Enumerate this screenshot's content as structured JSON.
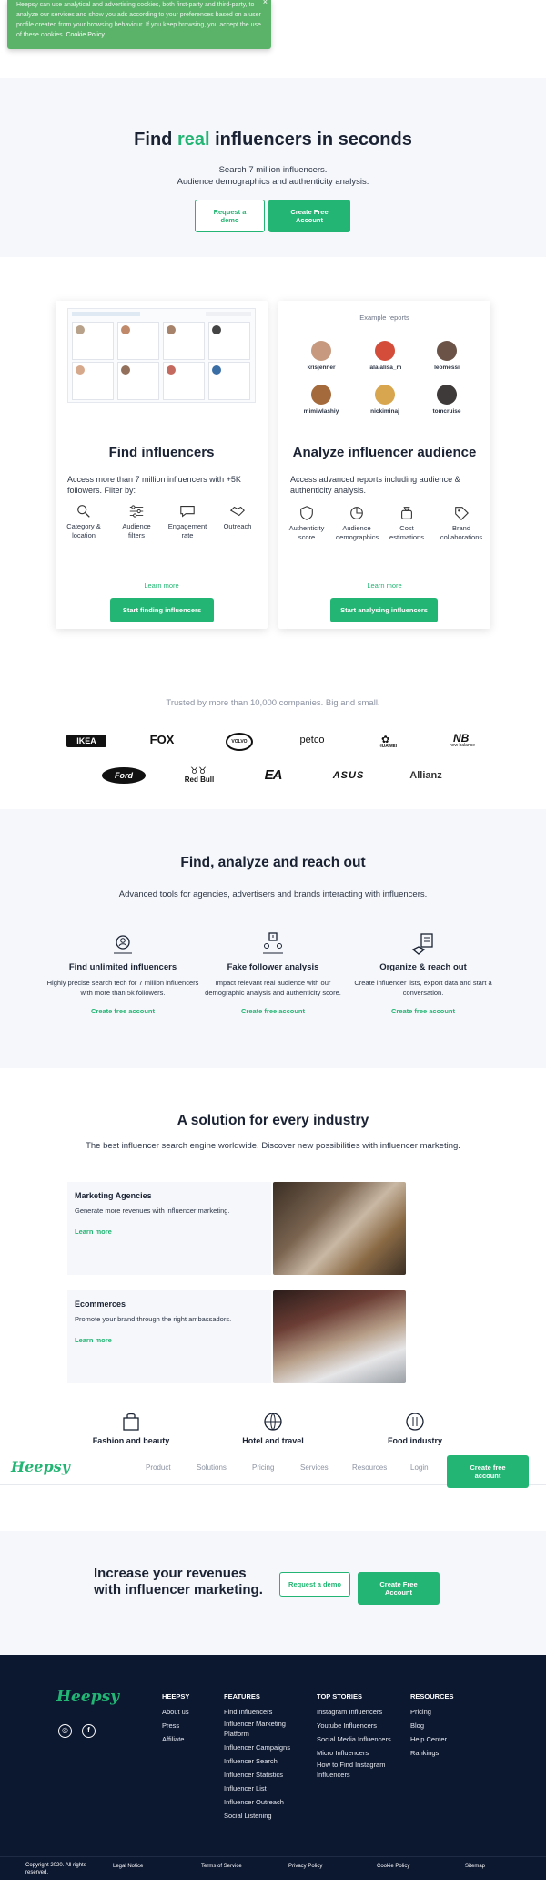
{
  "cookie": {
    "text": "Heepsy can use analytical and advertising cookies, both first-party and third-party, to analyze our services and show you ads according to your preferences based on a user profile created from your browsing behaviour. If you keep browsing, you accept the use of these cookies.",
    "link": "Cookie Policy",
    "close": "×"
  },
  "hero": {
    "title_pre": "Find ",
    "title_accent": "real",
    "title_post": " influencers in seconds",
    "sub1": "Search 7 million influencers.",
    "sub2": "Audience demographics and authenticity analysis.",
    "demo_btn": "Request a demo",
    "free_btn": "Create Free Account"
  },
  "card_find": {
    "title": "Find influencers",
    "desc": "Access more than 7 million influencers with +5K followers. Filter by:",
    "features": [
      "Category & location",
      "Audience filters",
      "Engagement rate",
      "Outreach"
    ],
    "learn": "Learn more",
    "cta": "Start finding influencers"
  },
  "card_analyze": {
    "example_title": "Example reports",
    "profiles": [
      "krisjenner",
      "lalalalisa_m",
      "leomessi",
      "mimiwlashiy",
      "nickiminaj",
      "tomcruise"
    ],
    "title": "Analyze influencer audience",
    "desc": "Access advanced reports including audience & authenticity analysis.",
    "features": [
      "Authenticity score",
      "Audience demographics",
      "Cost estimations",
      "Brand collaborations"
    ],
    "learn": "Learn more",
    "cta": "Start analysing influencers"
  },
  "trusted": {
    "title": "Trusted by more than 10,000 companies. Big and small.",
    "logos_row1": [
      "IKEA",
      "FOX",
      "VOLVO",
      "petco",
      "HUAWEI",
      "new balance"
    ],
    "logos_row2": [
      "Ford",
      "Red Bull",
      "EA",
      "ASUS",
      "Allianz"
    ]
  },
  "far": {
    "title": "Find, analyze and reach out",
    "sub": "Advanced tools for agencies, advertisers and brands interacting with influencers.",
    "cols": [
      {
        "title": "Find unlimited influencers",
        "text": "Highly precise search tech for 7 million influencers with more than 5k followers.",
        "link": "Create free account"
      },
      {
        "title": "Fake follower analysis",
        "text": "Impact relevant real audience with our demographic analysis and authenticity score.",
        "link": "Create free account"
      },
      {
        "title": "Organize & reach out",
        "text": "Create influencer lists, export data and start a conversation.",
        "link": "Create free account"
      }
    ]
  },
  "industry": {
    "title": "A solution for every industry",
    "sub": "The best influencer search engine worldwide. Discover new possibilities with influencer marketing.",
    "boxes": [
      {
        "title": "Marketing Agencies",
        "text": "Generate more revenues with influencer marketing.",
        "link": "Learn more"
      },
      {
        "title": "Ecommerces",
        "text": "Promote your brand through the right ambassadors.",
        "link": "Learn more"
      }
    ],
    "cats": [
      "Fashion and beauty",
      "Hotel and travel",
      "Food industry"
    ]
  },
  "nav": {
    "brand": "Heepsy",
    "items": [
      "Product",
      "Solutions",
      "Pricing",
      "Services",
      "Resources",
      "Login"
    ],
    "cta": "Create free account"
  },
  "band": {
    "title": "Increase your revenues with influencer marketing.",
    "demo_btn": "Request a demo",
    "free_btn": "Create Free Account"
  },
  "footer": {
    "brand": "Heepsy",
    "social": [
      "instagram-icon",
      "facebook-icon"
    ],
    "heepsy": {
      "title": "HEEPSY",
      "links": [
        "About us",
        "Press",
        "Affiliate"
      ]
    },
    "features": {
      "title": "FEATURES",
      "links": [
        "Find Influencers",
        "Influencer Marketing Platform",
        "Influencer Campaigns",
        "Influencer Search",
        "Influencer Statistics",
        "Influencer List",
        "Influencer Outreach",
        "Social Listening"
      ]
    },
    "stories": {
      "title": "TOP STORIES",
      "links": [
        "Instagram Influencers",
        "Youtube Influencers",
        "Social Media Influencers",
        "Micro Influencers",
        "How to Find Instagram Influencers"
      ]
    },
    "resources": {
      "title": "RESOURCES",
      "links": [
        "Pricing",
        "Blog",
        "Help Center",
        "Rankings"
      ]
    },
    "bottom": [
      "Copyright 2020. All rights reserved.",
      "Legal Notice",
      "Terms of Service",
      "Privacy Policy",
      "Cookie Policy",
      "Sitemap"
    ]
  },
  "colors": {
    "accent": "#22b573",
    "navy": "#0c1730",
    "light_bg": "#f5f7fa"
  }
}
